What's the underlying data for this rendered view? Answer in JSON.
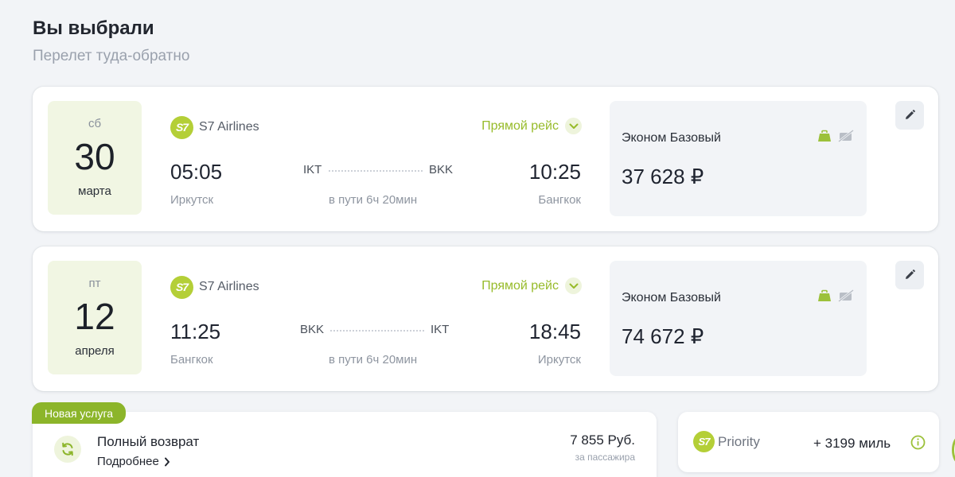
{
  "header": {
    "title": "Вы выбрали",
    "subtitle": "Перелет туда-обратно"
  },
  "flights": [
    {
      "weekday": "сб",
      "day": "30",
      "month": "марта",
      "airline": "S7 Airlines",
      "airline_logo_text": "S7",
      "direct_label": "Прямой рейс",
      "departure_time": "05:05",
      "arrival_time": "10:25",
      "from_code": "IKT",
      "to_code": "BKK",
      "from_city": "Иркутск",
      "to_city": "Бангкок",
      "duration": "в пути 6ч 20мин",
      "fare_name": "Эконом Базовый",
      "fare_price": "37 628 ₽"
    },
    {
      "weekday": "пт",
      "day": "12",
      "month": "апреля",
      "airline": "S7 Airlines",
      "airline_logo_text": "S7",
      "direct_label": "Прямой рейс",
      "departure_time": "11:25",
      "arrival_time": "18:45",
      "from_code": "BKK",
      "to_code": "IKT",
      "from_city": "Бангкок",
      "to_city": "Иркутск",
      "duration": "в пути 6ч 20мин",
      "fare_name": "Эконом Базовый",
      "fare_price": "74 672 ₽"
    }
  ],
  "service": {
    "badge": "Новая услуга",
    "title": "Полный возврат",
    "more_link": "Подробнее",
    "price": "7 855 Руб.",
    "per_passenger": "за пассажира"
  },
  "priority": {
    "logo_text": "S7",
    "name": "Priority",
    "miles": "+ 3199 миль"
  },
  "colors": {
    "accent": "#9cc13a",
    "accent_dark": "#8cb52a",
    "background": "#f2f4f7"
  }
}
